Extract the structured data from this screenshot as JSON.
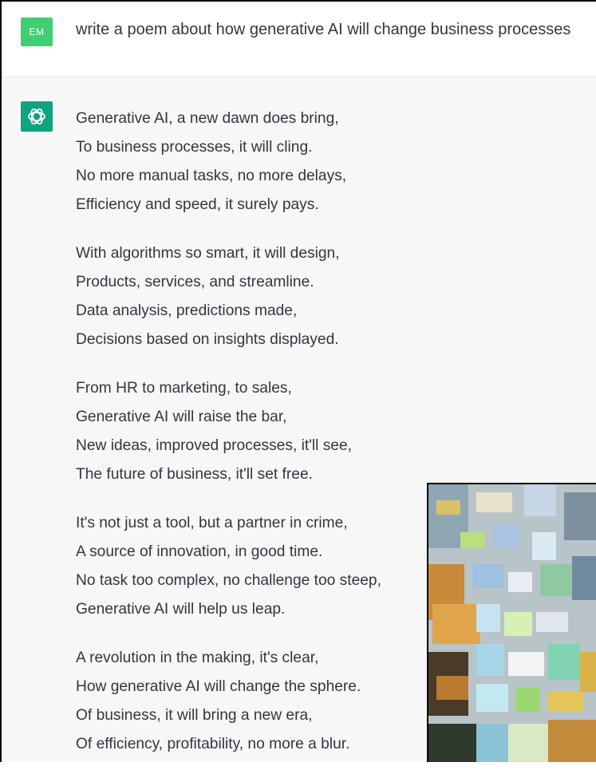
{
  "user": {
    "avatar_initials": "EM",
    "prompt": "write a poem about how generative AI will change business processes"
  },
  "assistant": {
    "icon": "openai-logo-icon",
    "stanzas": [
      [
        "Generative AI, a new dawn does bring,",
        "To business processes, it will cling.",
        "No more manual tasks, no more delays,",
        "Efficiency and speed, it surely pays."
      ],
      [
        "With algorithms so smart, it will design,",
        "Products, services, and streamline.",
        "Data analysis, predictions made,",
        "Decisions based on insights displayed."
      ],
      [
        "From HR to marketing, to sales,",
        "Generative AI will raise the bar,",
        "New ideas, improved processes, it'll see,",
        "The future of business, it'll set free."
      ],
      [
        "It's not just a tool, but a partner in crime,",
        "A source of innovation, in good time.",
        "No task too complex, no challenge too steep,",
        "Generative AI will help us leap."
      ],
      [
        "A revolution in the making, it's clear,",
        "How generative AI will change the sphere.",
        "Of business, it will bring a new era,",
        "Of efficiency, profitability, no more a blur."
      ]
    ]
  },
  "colors": {
    "user_avatar": "#3fcf73",
    "assistant_avatar": "#10a37f",
    "assistant_bg": "#f7f7f8",
    "text": "#343541"
  },
  "overlay": {
    "icon": "abstract-painting-image"
  }
}
